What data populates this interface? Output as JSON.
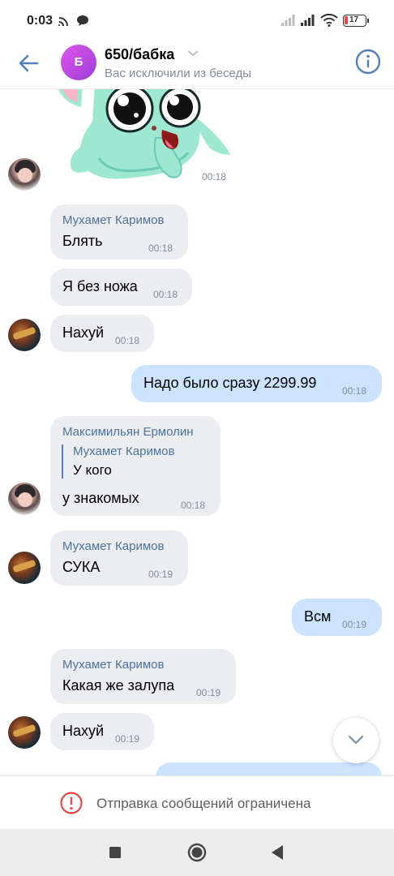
{
  "status_bar": {
    "time": "0:03",
    "battery_level": "17",
    "icons": [
      "cast-icon",
      "chat-bubble-icon",
      "signal-icon",
      "signal-icon",
      "wifi-icon",
      "battery-icon"
    ]
  },
  "header": {
    "avatar_letter": "Б",
    "title": "650/бабка",
    "subtitle": "Вас исключили из беседы",
    "accent_color": "#5181b8"
  },
  "messages": {
    "sticker_time": "00:18",
    "m1": {
      "sender": "Мухамет Каримов",
      "text": "Блять",
      "time": "00:18"
    },
    "m2": {
      "text": "Я без ножа",
      "time": "00:18"
    },
    "m3": {
      "text": "Нахуй",
      "time": "00:18"
    },
    "m4": {
      "text": "Надо было сразу 2299.99",
      "time": "00:18"
    },
    "m5": {
      "sender": "Максимильян Ермолин",
      "reply_sender": "Мухамет Каримов",
      "reply_text": "У кого",
      "text": "у знакомых",
      "time": "00:18"
    },
    "m6": {
      "sender": "Мухамет Каримов",
      "text": "СУКА",
      "time": "00:19"
    },
    "m7": {
      "text": "Всм",
      "time": "00:19"
    },
    "m8": {
      "sender": "Мухамет Каримов",
      "text": "Какая же залупа",
      "time": "00:19"
    },
    "m9": {
      "text": "Нахуй",
      "time": "00:19"
    }
  },
  "restricted": {
    "text": "Отправка сообщений ограничена"
  },
  "colors": {
    "incoming_bubble": "#ebedf0",
    "outgoing_bubble": "#cce4ff",
    "sender_name": "#4d7199",
    "timestamp": "#818c99",
    "warning": "#e64646"
  }
}
